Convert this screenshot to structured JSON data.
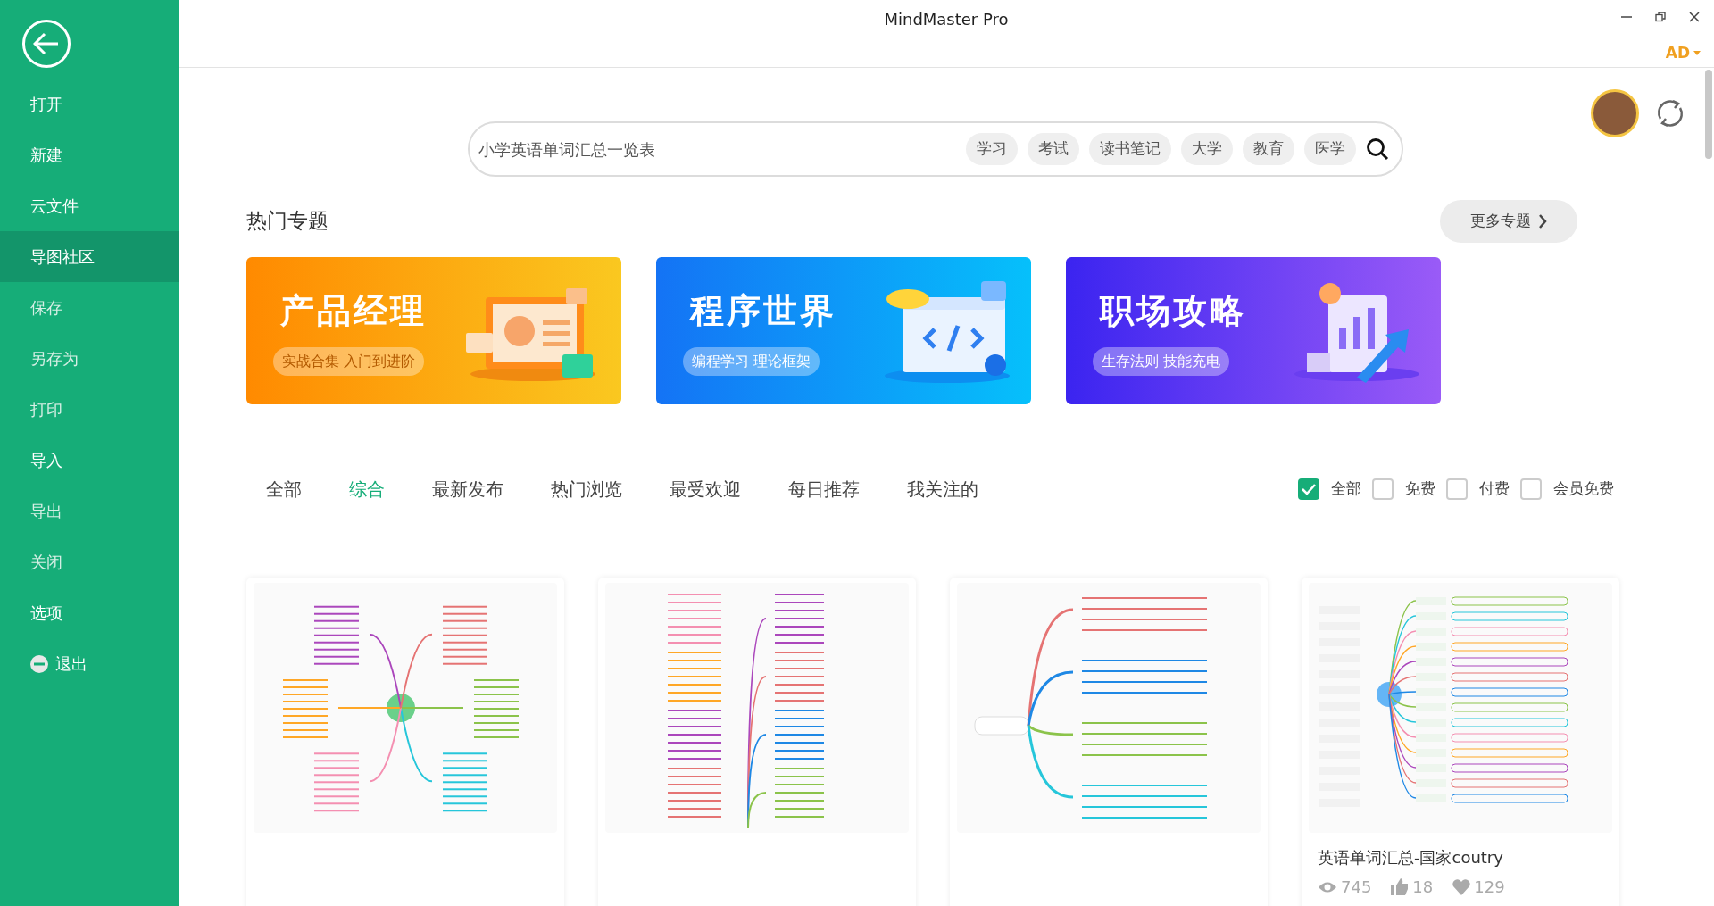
{
  "window": {
    "title": "MindMaster Pro",
    "account": "AD"
  },
  "sidebar": {
    "items": [
      {
        "label": "打开",
        "selected": false,
        "disabled": false,
        "kind": "plain"
      },
      {
        "label": "新建",
        "selected": false,
        "disabled": false,
        "kind": "plain"
      },
      {
        "label": "云文件",
        "selected": false,
        "disabled": false,
        "kind": "plain"
      },
      {
        "label": "导图社区",
        "selected": true,
        "disabled": false,
        "kind": "plain"
      },
      {
        "label": "保存",
        "selected": false,
        "disabled": true,
        "kind": "plain"
      },
      {
        "label": "另存为",
        "selected": false,
        "disabled": true,
        "kind": "plain"
      },
      {
        "label": "打印",
        "selected": false,
        "disabled": true,
        "kind": "plain"
      },
      {
        "label": "导入",
        "selected": false,
        "disabled": false,
        "kind": "plain"
      },
      {
        "label": "导出",
        "selected": false,
        "disabled": true,
        "kind": "plain"
      },
      {
        "label": "关闭",
        "selected": false,
        "disabled": true,
        "kind": "plain"
      },
      {
        "label": "选项",
        "selected": false,
        "disabled": false,
        "kind": "plain"
      },
      {
        "label": "退出",
        "selected": false,
        "disabled": false,
        "kind": "exit"
      }
    ]
  },
  "search": {
    "placeholder": "小学英语单词汇总一览表",
    "tags": [
      "学习",
      "考试",
      "读书笔记",
      "大学",
      "教育",
      "医学"
    ]
  },
  "section": {
    "title": "热门专题",
    "more": "更多专题"
  },
  "banners": [
    {
      "kind": "product",
      "title": "产品经理",
      "subtitle": "实战合集 入门到进阶"
    },
    {
      "kind": "code",
      "title": "程序世界",
      "subtitle": "编程学习 理论框架"
    },
    {
      "kind": "career",
      "title": "职场攻略",
      "subtitle": "生存法则 技能充电"
    }
  ],
  "tabs": [
    {
      "label": "全部",
      "selected": false
    },
    {
      "label": "综合",
      "selected": true
    },
    {
      "label": "最新发布",
      "selected": false
    },
    {
      "label": "热门浏览",
      "selected": false
    },
    {
      "label": "最受欢迎",
      "selected": false
    },
    {
      "label": "每日推荐",
      "selected": false
    },
    {
      "label": "我关注的",
      "selected": false
    }
  ],
  "filters": [
    {
      "label": "全部",
      "checked": true
    },
    {
      "label": "免费",
      "checked": false
    },
    {
      "label": "付费",
      "checked": false
    },
    {
      "label": "会员免费",
      "checked": false
    }
  ],
  "cards": [
    {
      "kind": "radial"
    },
    {
      "kind": "tree"
    },
    {
      "kind": "branch"
    },
    {
      "kind": "table",
      "title": "英语单词汇总-国家coutry",
      "views": "745",
      "likes": "18",
      "favorites": "129"
    }
  ]
}
